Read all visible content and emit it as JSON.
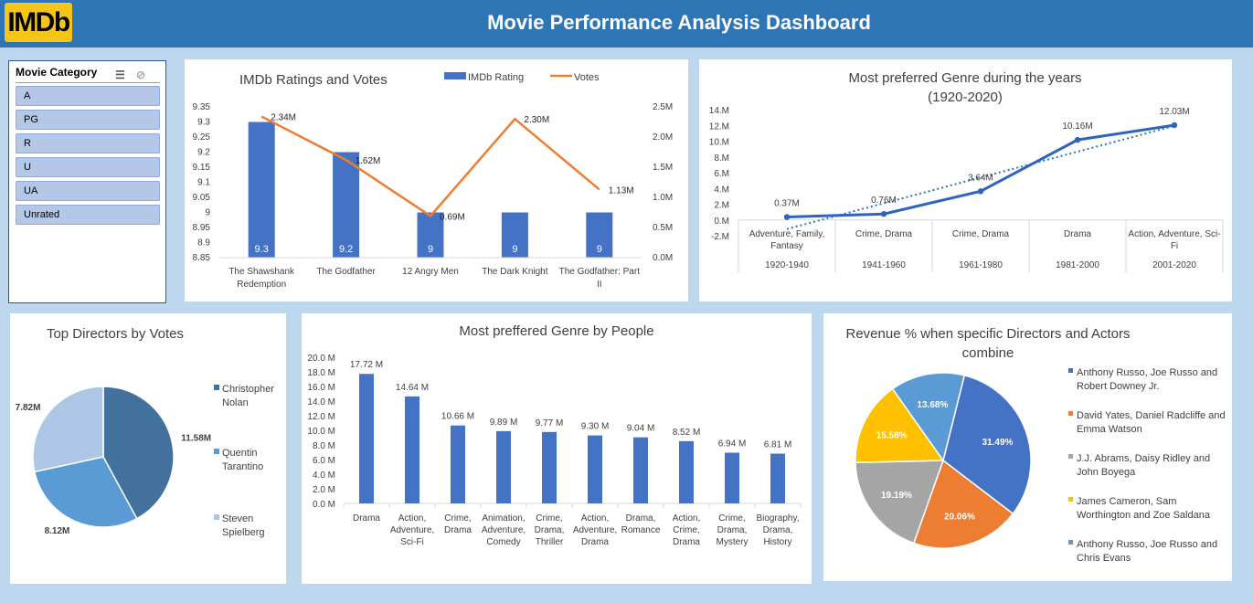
{
  "header": {
    "logo": "IMDb",
    "title": "Movie Performance Analysis Dashboard"
  },
  "slicer": {
    "title": "Movie Category",
    "icons": [
      "multi-select-icon",
      "clear-filter-icon"
    ],
    "items": [
      "A",
      "PG",
      "R",
      "U",
      "UA",
      "Unrated"
    ]
  },
  "colors": {
    "header": "#2e75b6",
    "bar": "#4472c4",
    "votes_line": "#ed7d31",
    "background": "#bdd7ee",
    "logo": "#f5c518"
  },
  "chart_data": [
    {
      "id": "ratings-votes",
      "type": "bar",
      "title": "IMDb Ratings and Votes",
      "legend": [
        "IMDb Rating",
        "Votes"
      ],
      "legend_position": "top",
      "categories": [
        "The Shawshank Redemption",
        "The Godfather",
        "12 Angry Men",
        "The Dark Knight",
        "The Godfather: Part II"
      ],
      "category_lines": [
        [
          "The Shawshank",
          "Redemption"
        ],
        [
          "The Godfather"
        ],
        [
          "12 Angry Men"
        ],
        [
          "The Dark Knight"
        ],
        [
          "The Godfather: Part",
          "II"
        ]
      ],
      "series": [
        {
          "name": "IMDb Rating",
          "type": "bar",
          "axis": "left",
          "values": [
            9.3,
            9.2,
            9,
            9,
            9
          ],
          "labels": [
            "9.3",
            "9.2",
            "9",
            "9",
            "9"
          ]
        },
        {
          "name": "Votes",
          "type": "line",
          "axis": "right",
          "values": [
            2.34,
            1.62,
            0.69,
            2.3,
            1.13
          ],
          "labels": [
            "2.34M",
            "1.62M",
            "0.69M",
            "2.30M",
            "1.13M"
          ]
        }
      ],
      "ylim": [
        8.85,
        9.35
      ],
      "yticks": [
        "9.35",
        "9.3",
        "9.25",
        "9.2",
        "9.15",
        "9.1",
        "9.05",
        "9",
        "8.95",
        "8.9",
        "8.85"
      ],
      "y2lim": [
        0,
        2.5
      ],
      "y2ticks": [
        "2.5M",
        "2.0M",
        "1.5M",
        "1.0M",
        "0.5M",
        "0.0M"
      ]
    },
    {
      "id": "genre-years",
      "type": "line",
      "title": [
        "Most preferred Genre during the years",
        "(1920-2020)"
      ],
      "categories": [
        "Adventure, Family, Fantasy",
        "Crime, Drama",
        "Crime, Drama",
        "Drama",
        "Action, Adventure, Sci-Fi"
      ],
      "category_lines": [
        [
          "Adventure, Family,",
          "Fantasy"
        ],
        [
          "Crime, Drama"
        ],
        [
          "Crime, Drama"
        ],
        [
          "Drama"
        ],
        [
          "Action, Adventure, Sci-",
          "Fi"
        ]
      ],
      "periods": [
        "1920-1940",
        "1941-1960",
        "1961-1980",
        "1981-2000",
        "2001-2020"
      ],
      "values": [
        0.37,
        0.76,
        3.64,
        10.16,
        12.03
      ],
      "labels": [
        "0.37M",
        "0.76M",
        "3.64M",
        "10.16M",
        "12.03M"
      ],
      "trendline": "linear",
      "ylim": [
        -2,
        14
      ],
      "yticks": [
        "14.M",
        "12.M",
        "10.M",
        "8.M",
        "6.M",
        "4.M",
        "2.M",
        "0.M",
        "-2.M"
      ]
    },
    {
      "id": "top-directors",
      "type": "pie",
      "title": "Top Directors by Votes",
      "legend_position": "right",
      "series": [
        {
          "name": "Christopher Nolan",
          "lines": [
            "Christopher",
            "Nolan"
          ],
          "value": 11.58,
          "label": "11.58M",
          "color": "#41719c"
        },
        {
          "name": "Quentin Tarantino",
          "lines": [
            "Quentin",
            "Tarantino"
          ],
          "value": 8.12,
          "label": "8.12M",
          "color": "#5b9bd5"
        },
        {
          "name": "Steven Spielberg",
          "lines": [
            "Steven",
            "Spielberg"
          ],
          "value": 7.82,
          "label": "7.82M",
          "color": "#adc6e5"
        }
      ]
    },
    {
      "id": "genre-people",
      "type": "bar",
      "title": "Most preffered Genre by People",
      "categories": [
        "Drama",
        "Action, Adventure, Sci-Fi",
        "Crime, Drama",
        "Animation, Adventure, Comedy",
        "Crime, Drama, Thriller",
        "Action, Adventure, Drama",
        "Drama, Romance",
        "Action, Crime, Drama",
        "Crime, Drama, Mystery",
        "Biography, Drama, History"
      ],
      "category_lines": [
        [
          "Drama"
        ],
        [
          "Action,",
          "Adventure,",
          "Sci-Fi"
        ],
        [
          "Crime,",
          "Drama"
        ],
        [
          "Animation,",
          "Adventure,",
          "Comedy"
        ],
        [
          "Crime,",
          "Drama,",
          "Thriller"
        ],
        [
          "Action,",
          "Adventure,",
          "Drama"
        ],
        [
          "Drama,",
          "Romance"
        ],
        [
          "Action,",
          "Crime,",
          "Drama"
        ],
        [
          "Crime,",
          "Drama,",
          "Mystery"
        ],
        [
          "Biography,",
          "Drama,",
          "History"
        ]
      ],
      "values": [
        17.72,
        14.64,
        10.66,
        9.89,
        9.77,
        9.3,
        9.04,
        8.52,
        6.94,
        6.81
      ],
      "labels": [
        "17.72 M",
        "14.64 M",
        "10.66 M",
        "9.89 M",
        "9.77 M",
        "9.30 M",
        "9.04 M",
        "8.52 M",
        "6.94 M",
        "6.81 M"
      ],
      "ylim": [
        0,
        20
      ],
      "yticks": [
        "20.0 M",
        "18.0 M",
        "16.0 M",
        "14.0 M",
        "12.0 M",
        "10.0 M",
        "8.0 M",
        "6.0 M",
        "4.0 M",
        "2.0 M",
        "0.0 M"
      ]
    },
    {
      "id": "revenue-combos",
      "type": "pie",
      "title": [
        "Revenue % when specific Directors and Actors",
        "combine"
      ],
      "legend_position": "right",
      "series": [
        {
          "name": "Anthony Russo, Joe Russo and Robert Downey Jr.",
          "lines": [
            "Anthony Russo, Joe Russo and",
            "Robert Downey Jr."
          ],
          "value": 31.49,
          "label": "31.49%",
          "color": "#4472c4"
        },
        {
          "name": "David Yates, Daniel Radcliffe and Emma Watson",
          "lines": [
            "David Yates, Daniel Radcliffe and",
            "Emma Watson"
          ],
          "value": 20.06,
          "label": "20.06%",
          "color": "#ed7d31"
        },
        {
          "name": "J.J. Abrams, Daisy Ridley and John Boyega",
          "lines": [
            "J.J. Abrams, Daisy Ridley and",
            "John Boyega"
          ],
          "value": 19.19,
          "label": "19.19%",
          "color": "#a5a5a5"
        },
        {
          "name": "James Cameron, Sam Worthington and Zoe Saldana",
          "lines": [
            "James Cameron, Sam",
            "Worthington and Zoe Saldana"
          ],
          "value": 15.58,
          "label": "15.58%",
          "color": "#ffc000"
        },
        {
          "name": "Anthony Russo, Joe Russo and Chris Evans",
          "lines": [
            "Anthony Russo, Joe Russo and",
            "Chris Evans"
          ],
          "value": 13.68,
          "label": "13.68%",
          "color": "#5b9bd5"
        }
      ]
    }
  ]
}
